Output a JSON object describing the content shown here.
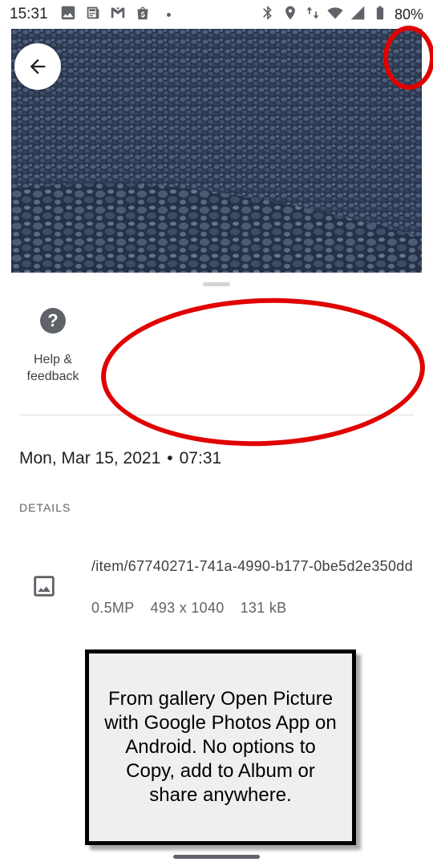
{
  "status_bar": {
    "time": "15:31",
    "battery": "80%",
    "left_icons": [
      "image-icon",
      "news-icon",
      "gmail-icon",
      "shopping-icon"
    ],
    "right_icons": [
      "bluetooth-icon",
      "location-icon",
      "data-arrows-icon",
      "wifi-icon",
      "signal-icon",
      "battery-icon"
    ]
  },
  "photo": {
    "description_icon": "gravel-photo",
    "back_icon": "arrow-back-icon"
  },
  "sheet": {
    "help_action": {
      "label": "Help & feedback",
      "icon": "help-icon"
    },
    "date": "Mon, Mar 15, 2021",
    "time": "07:31",
    "details_heading": "DETAILS",
    "file": {
      "icon": "image-file-icon",
      "path": "/item/67740271-741a-4990-b177-0be5d2e350dd",
      "megapixels": "0.5MP",
      "dimensions": "493 x 1040",
      "size": "131 kB"
    }
  },
  "annotation": {
    "note": "From gallery Open Picture with Google Photos App on Android. No options to Copy, add to Album or share anywhere.",
    "circle_color": "#e00000"
  },
  "colors": {
    "text_primary": "#202124",
    "text_secondary": "#5f6368",
    "divider": "#dadce0",
    "photo_base": "#2f3b52"
  }
}
